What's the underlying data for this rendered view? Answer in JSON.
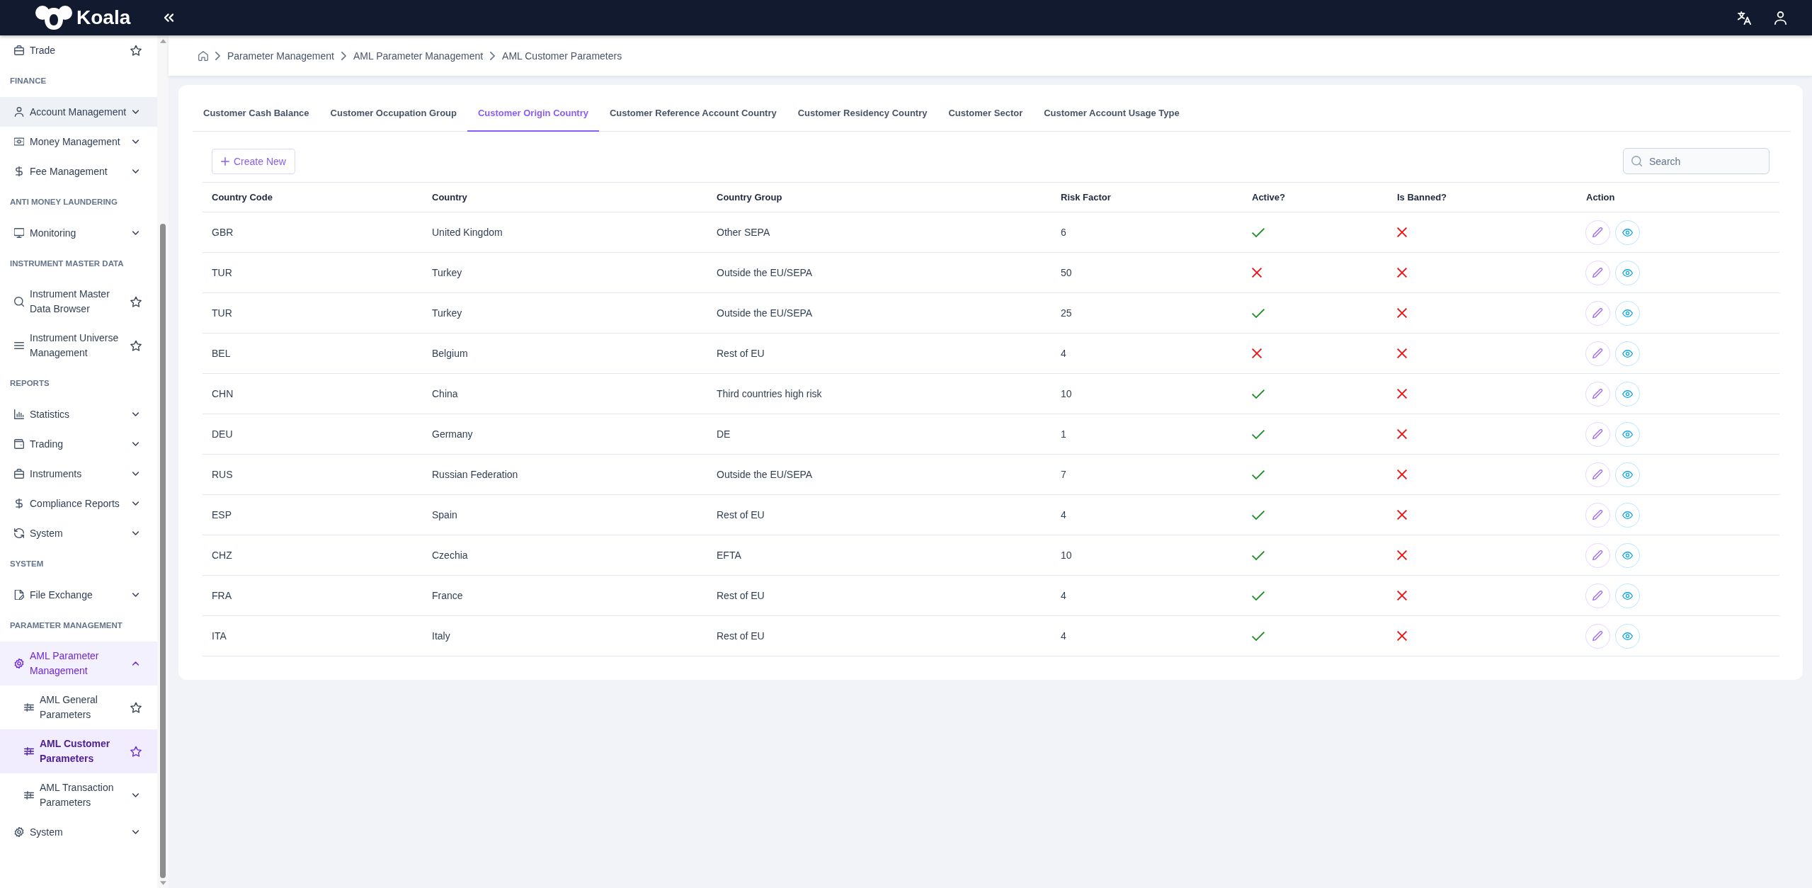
{
  "topbar": {
    "logo": "Koala"
  },
  "sidebar": {
    "sections": [
      {
        "items": [
          {
            "label": "Trade",
            "kind": "link",
            "selected": false,
            "hovered": false
          }
        ]
      },
      {
        "title": "FINANCE",
        "items": [
          {
            "label": "Account Management",
            "kind": "group",
            "selected": false,
            "hovered": true,
            "expanded": false
          },
          {
            "label": "Money Management",
            "kind": "group",
            "selected": false,
            "hovered": false,
            "expanded": false
          },
          {
            "label": "Fee Management",
            "kind": "group",
            "selected": false,
            "hovered": false,
            "expanded": false
          }
        ]
      },
      {
        "title": "ANTI MONEY LAUNDERING",
        "items": [
          {
            "label": "Monitoring",
            "kind": "group",
            "selected": false,
            "hovered": false,
            "expanded": false
          }
        ]
      },
      {
        "title": "INSTRUMENT MASTER DATA",
        "items": [
          {
            "label": "Instrument Master Data Browser",
            "kind": "link",
            "selected": false,
            "hovered": false
          },
          {
            "label": "Instrument Universe Management",
            "kind": "link",
            "selected": false,
            "hovered": false
          }
        ]
      },
      {
        "title": "REPORTS",
        "items": [
          {
            "label": "Statistics",
            "kind": "group",
            "selected": false,
            "hovered": false,
            "expanded": false
          },
          {
            "label": "Trading",
            "kind": "group",
            "selected": false,
            "hovered": false,
            "expanded": false
          },
          {
            "label": "Instruments",
            "kind": "group",
            "selected": false,
            "hovered": false,
            "expanded": false
          },
          {
            "label": "Compliance Reports",
            "kind": "group",
            "selected": false,
            "hovered": false,
            "expanded": false
          },
          {
            "label": "System",
            "kind": "group",
            "selected": false,
            "hovered": false,
            "expanded": false
          }
        ]
      },
      {
        "title": "SYSTEM",
        "items": [
          {
            "label": "File Exchange",
            "kind": "group",
            "selected": false,
            "hovered": false,
            "expanded": false
          }
        ]
      },
      {
        "title": "PARAMETER MANAGEMENT",
        "items": [
          {
            "label": "AML Parameter Management",
            "kind": "group",
            "selected": false,
            "hovered": false,
            "expanded": true,
            "children": [
              {
                "label": "AML General Parameters",
                "kind": "link",
                "selected": false,
                "hovered": false
              },
              {
                "label": "AML Customer Parameters",
                "kind": "link",
                "selected": true,
                "hovered": false
              },
              {
                "label": "AML Transaction Parameters",
                "kind": "group",
                "selected": false,
                "hovered": false,
                "expanded": false
              }
            ]
          },
          {
            "label": "System",
            "kind": "group",
            "selected": false,
            "hovered": false,
            "expanded": false
          }
        ]
      }
    ]
  },
  "breadcrumb": [
    "Parameter Management",
    "AML Parameter Management",
    "AML Customer Parameters"
  ],
  "tabs": [
    {
      "label": "Customer Cash Balance",
      "selected": false
    },
    {
      "label": "Customer Occupation Group",
      "selected": false
    },
    {
      "label": "Customer Origin Country",
      "selected": true
    },
    {
      "label": "Customer Reference Account Country",
      "selected": false
    },
    {
      "label": "Customer Residency Country",
      "selected": false
    },
    {
      "label": "Customer Sector",
      "selected": false
    },
    {
      "label": "Customer Account Usage Type",
      "selected": false
    }
  ],
  "toolbar": {
    "create_button": "Create New",
    "search": {
      "placeholder": "Search"
    }
  },
  "table": {
    "columns": [
      "Country Code",
      "Country",
      "Country Group",
      "Risk Factor",
      "Active?",
      "Is Banned?",
      "Action"
    ],
    "rows": [
      {
        "code": "GBR",
        "country": "United Kingdom",
        "group": "Other SEPA",
        "risk_factor": "6",
        "active": true,
        "banned": false
      },
      {
        "code": "TUR",
        "country": "Turkey",
        "group": "Outside the EU/SEPA",
        "risk_factor": "50",
        "active": false,
        "banned": false
      },
      {
        "code": "TUR",
        "country": "Turkey",
        "group": "Outside the EU/SEPA",
        "risk_factor": "25",
        "active": true,
        "banned": false
      },
      {
        "code": "BEL",
        "country": "Belgium",
        "group": "Rest of EU",
        "risk_factor": "4",
        "active": false,
        "banned": false
      },
      {
        "code": "CHN",
        "country": "China",
        "group": "Third countries high risk",
        "risk_factor": "10",
        "active": true,
        "banned": false
      },
      {
        "code": "DEU",
        "country": "Germany",
        "group": "DE",
        "risk_factor": "1",
        "active": true,
        "banned": false
      },
      {
        "code": "RUS",
        "country": "Russian Federation",
        "group": "Outside the EU/SEPA",
        "risk_factor": "7",
        "active": true,
        "banned": false
      },
      {
        "code": "ESP",
        "country": "Spain",
        "group": "Rest of EU",
        "risk_factor": "4",
        "active": true,
        "banned": false
      },
      {
        "code": "CHZ",
        "country": "Czechia",
        "group": "EFTA",
        "risk_factor": "10",
        "active": true,
        "banned": false
      },
      {
        "code": "FRA",
        "country": "France",
        "group": "Rest of EU",
        "risk_factor": "4",
        "active": true,
        "banned": false
      },
      {
        "code": "ITA",
        "country": "Italy",
        "group": "Rest of EU",
        "risk_factor": "4",
        "active": true,
        "banned": false
      }
    ]
  }
}
